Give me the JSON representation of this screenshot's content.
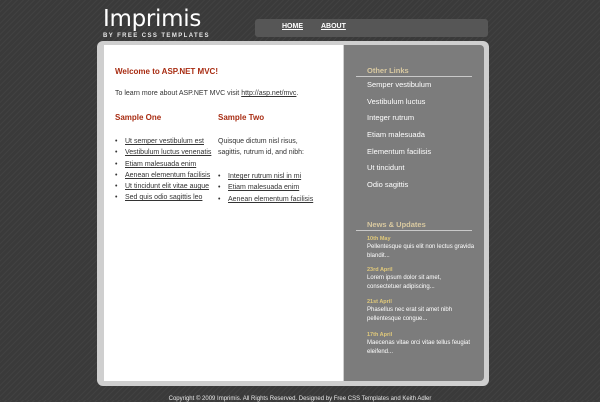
{
  "header": {
    "logo_title": "Imprimis",
    "logo_tagline": "BY FREE CSS TEMPLATES"
  },
  "nav": {
    "items": [
      "HOME",
      "ABOUT"
    ]
  },
  "content": {
    "welcome_heading": "Welcome to ASP.NET MVC!",
    "intro_text": "To learn more about ASP.NET MVC visit ",
    "intro_link": "http://asp.net/mvc",
    "intro_end": ".",
    "sample_one": {
      "heading": "Sample One",
      "items": [
        "Ut semper vestibulum est",
        "Vestibulum luctus venenatis",
        "Etiam malesuada enim",
        "Aenean elementum facilisis",
        "Ut tincidunt elit vitae augue",
        "Sed quis odio sagittis leo"
      ]
    },
    "sample_two": {
      "heading": "Sample Two",
      "text": "Quisque dictum nisl risus, sagittis, rutrum id, and nibh:",
      "items": [
        "Integer rutrum nisl in mi",
        "Etiam malesuada enim",
        "Aenean elementum facilisis"
      ]
    }
  },
  "sidebar": {
    "other_links_heading": "Other Links",
    "other_links": [
      "Semper vestibulum",
      "Vestibulum luctus",
      "Integer rutrum",
      "Etiam malesuada",
      "Elementum facilisis",
      "Ut tincidunt",
      "Odio sagittis"
    ],
    "news_heading": "News & Updates",
    "news": [
      {
        "date": "10th May",
        "text": "Pellentesque quis elit non lectus gravida blandit..."
      },
      {
        "date": "23rd April",
        "text": "Lorem ipsum dolor sit amet, consectetuer adipiscing..."
      },
      {
        "date": "21st April",
        "text": "Phasellus nec erat sit amet nibh pellentesque congue..."
      },
      {
        "date": "17th April",
        "text": "Maecenas vitae orci vitae tellus feugiat eleifend..."
      }
    ]
  },
  "footer": {
    "text": "Copyright © 2009 Imprimis. All Rights Reserved. Designed by Free CSS Templates and Keith Adler"
  }
}
